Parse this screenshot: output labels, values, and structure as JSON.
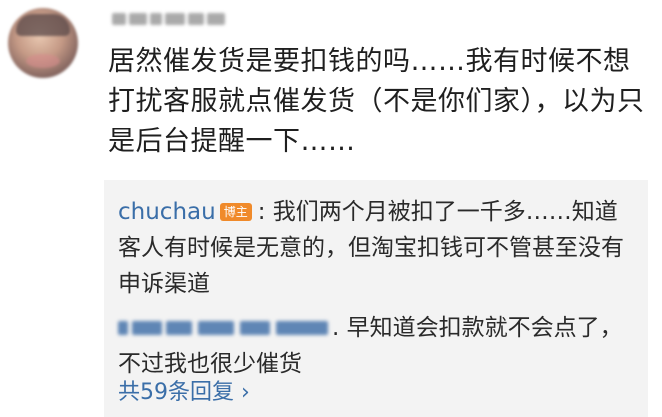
{
  "comment": {
    "text": "居然催发货是要扣钱的吗……我有时候不想打扰客服就点催发货（不是你们家），以为只是后台提醒一下……"
  },
  "replies": [
    {
      "name": "chuchau",
      "badge": "博主",
      "text": ": 我们两个月被扣了一千多……知道客人有时候是无意的，但淘宝扣钱可不管甚至没有申诉渠道"
    },
    {
      "text": ". 早知道会扣款就不会点了，不过我也很少催货"
    }
  ],
  "more_replies": {
    "label": "共59条回复 ›"
  }
}
